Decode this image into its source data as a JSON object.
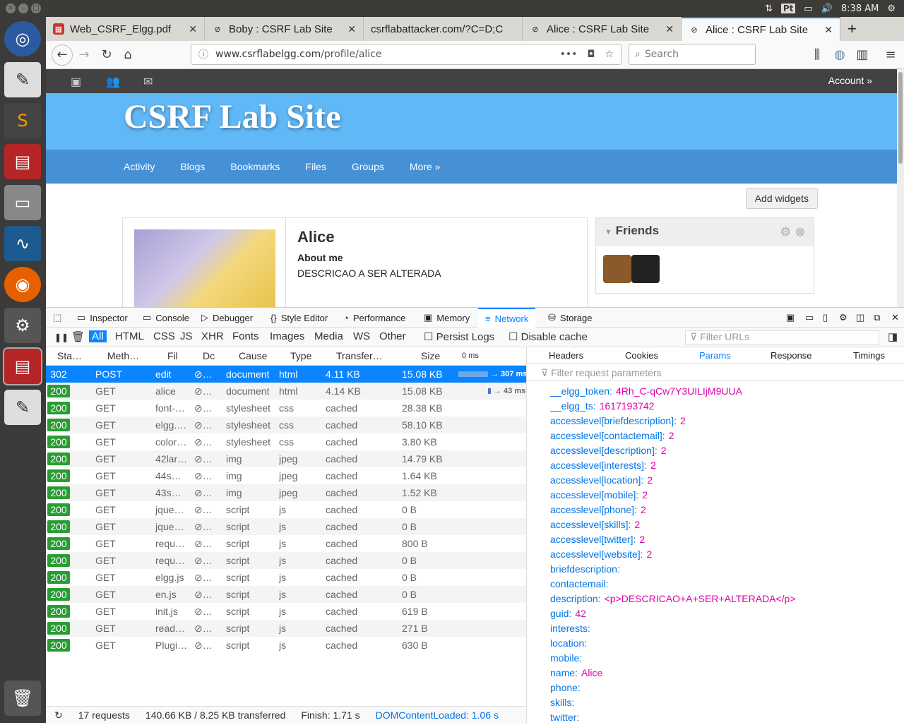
{
  "system": {
    "lang": "Pt",
    "time": "8:38 AM"
  },
  "tabs": [
    {
      "label": "Web_CSRF_Elgg.pdf",
      "active": false
    },
    {
      "label": "Boby : CSRF Lab Site",
      "active": false
    },
    {
      "label": "csrflabattacker.com/?C=D;C",
      "active": false
    },
    {
      "label": "Alice : CSRF Lab Site",
      "active": false
    },
    {
      "label": "Alice : CSRF Lab Site",
      "active": true
    }
  ],
  "urlbar": {
    "domain": "www.csrflabelgg.com",
    "path": "/profile/alice"
  },
  "search": {
    "placeholder": "Search"
  },
  "site": {
    "account": "Account »",
    "title": "CSRF Lab Site",
    "menu": [
      "Activity",
      "Blogs",
      "Bookmarks",
      "Files",
      "Groups",
      "More »"
    ],
    "add_widgets": "Add widgets",
    "profile": {
      "name": "Alice",
      "about_label": "About me",
      "description": "DESCRICAO A SER ALTERADA"
    },
    "friends_title": "Friends"
  },
  "devtools": {
    "tabs": [
      "Inspector",
      "Console",
      "Debugger",
      "Style Editor",
      "Performance",
      "Memory",
      "Network",
      "Storage"
    ],
    "filters": [
      "All",
      "HTML",
      "CSS",
      "JS",
      "XHR",
      "Fonts",
      "Images",
      "Media",
      "WS",
      "Other"
    ],
    "persist_logs": "Persist Logs",
    "disable_cache": "Disable cache",
    "filter_urls_placeholder": "Filter URLs",
    "columns": [
      "Sta…",
      "Meth…",
      "Fil",
      "Dc",
      "Cause",
      "Type",
      "Transfer…",
      "Size",
      "0 ms"
    ],
    "requests": [
      {
        "status": "302",
        "method": "POST",
        "file": "edit",
        "cause": "document",
        "type": "html",
        "transferred": "4.11 KB",
        "size": "15.08 KB",
        "timing": "→ 307 ms"
      },
      {
        "status": "200",
        "method": "GET",
        "file": "alice",
        "cause": "document",
        "type": "html",
        "transferred": "4.14 KB",
        "size": "15.08 KB",
        "timing": "→ 43 ms"
      },
      {
        "status": "200",
        "method": "GET",
        "file": "font-…",
        "cause": "stylesheet",
        "type": "css",
        "transferred": "cached",
        "size": "28.38 KB",
        "timing": ""
      },
      {
        "status": "200",
        "method": "GET",
        "file": "elgg.…",
        "cause": "stylesheet",
        "type": "css",
        "transferred": "cached",
        "size": "58.10 KB",
        "timing": ""
      },
      {
        "status": "200",
        "method": "GET",
        "file": "color…",
        "cause": "stylesheet",
        "type": "css",
        "transferred": "cached",
        "size": "3.80 KB",
        "timing": ""
      },
      {
        "status": "200",
        "method": "GET",
        "file": "42lar…",
        "cause": "img",
        "type": "jpeg",
        "transferred": "cached",
        "size": "14.79 KB",
        "timing": ""
      },
      {
        "status": "200",
        "method": "GET",
        "file": "44s…",
        "cause": "img",
        "type": "jpeg",
        "transferred": "cached",
        "size": "1.64 KB",
        "timing": ""
      },
      {
        "status": "200",
        "method": "GET",
        "file": "43s…",
        "cause": "img",
        "type": "jpeg",
        "transferred": "cached",
        "size": "1.52 KB",
        "timing": ""
      },
      {
        "status": "200",
        "method": "GET",
        "file": "jque…",
        "cause": "script",
        "type": "js",
        "transferred": "cached",
        "size": "0 B",
        "timing": ""
      },
      {
        "status": "200",
        "method": "GET",
        "file": "jque…",
        "cause": "script",
        "type": "js",
        "transferred": "cached",
        "size": "0 B",
        "timing": ""
      },
      {
        "status": "200",
        "method": "GET",
        "file": "requ…",
        "cause": "script",
        "type": "js",
        "transferred": "cached",
        "size": "800 B",
        "timing": ""
      },
      {
        "status": "200",
        "method": "GET",
        "file": "requ…",
        "cause": "script",
        "type": "js",
        "transferred": "cached",
        "size": "0 B",
        "timing": ""
      },
      {
        "status": "200",
        "method": "GET",
        "file": "elgg.js",
        "cause": "script",
        "type": "js",
        "transferred": "cached",
        "size": "0 B",
        "timing": ""
      },
      {
        "status": "200",
        "method": "GET",
        "file": "en.js",
        "cause": "script",
        "type": "js",
        "transferred": "cached",
        "size": "0 B",
        "timing": ""
      },
      {
        "status": "200",
        "method": "GET",
        "file": "init.js",
        "cause": "script",
        "type": "js",
        "transferred": "cached",
        "size": "619 B",
        "timing": ""
      },
      {
        "status": "200",
        "method": "GET",
        "file": "read…",
        "cause": "script",
        "type": "js",
        "transferred": "cached",
        "size": "271 B",
        "timing": ""
      },
      {
        "status": "200",
        "method": "GET",
        "file": "Plugi…",
        "cause": "script",
        "type": "js",
        "transferred": "cached",
        "size": "630 B",
        "timing": ""
      }
    ],
    "summary": {
      "requests": "17 requests",
      "transferred": "140.66 KB / 8.25 KB transferred",
      "finish": "Finish: 1.71 s",
      "dcl": "DOMContentLoaded: 1.06 s"
    },
    "detail_tabs": [
      "Headers",
      "Cookies",
      "Params",
      "Response",
      "Timings"
    ],
    "params_filter_placeholder": "Filter request parameters",
    "params": [
      {
        "key": "__elgg_token:",
        "value": "4Rh_C-qCw7Y3UILIjM9UUA"
      },
      {
        "key": "__elgg_ts:",
        "value": "1617193742"
      },
      {
        "key": "accesslevel[briefdescription]:",
        "value": "2"
      },
      {
        "key": "accesslevel[contactemail]:",
        "value": "2"
      },
      {
        "key": "accesslevel[description]:",
        "value": "2"
      },
      {
        "key": "accesslevel[interests]:",
        "value": "2"
      },
      {
        "key": "accesslevel[location]:",
        "value": "2"
      },
      {
        "key": "accesslevel[mobile]:",
        "value": "2"
      },
      {
        "key": "accesslevel[phone]:",
        "value": "2"
      },
      {
        "key": "accesslevel[skills]:",
        "value": "2"
      },
      {
        "key": "accesslevel[twitter]:",
        "value": "2"
      },
      {
        "key": "accesslevel[website]:",
        "value": "2"
      },
      {
        "key": "briefdescription:",
        "value": ""
      },
      {
        "key": "contactemail:",
        "value": ""
      },
      {
        "key": "description:",
        "value": "<p>DESCRICAO+A+SER+ALTERADA</p>"
      },
      {
        "key": "guid:",
        "value": "42"
      },
      {
        "key": "interests:",
        "value": ""
      },
      {
        "key": "location:",
        "value": ""
      },
      {
        "key": "mobile:",
        "value": ""
      },
      {
        "key": "name:",
        "value": "Alice"
      },
      {
        "key": "phone:",
        "value": ""
      },
      {
        "key": "skills:",
        "value": ""
      },
      {
        "key": "twitter:",
        "value": ""
      }
    ]
  }
}
